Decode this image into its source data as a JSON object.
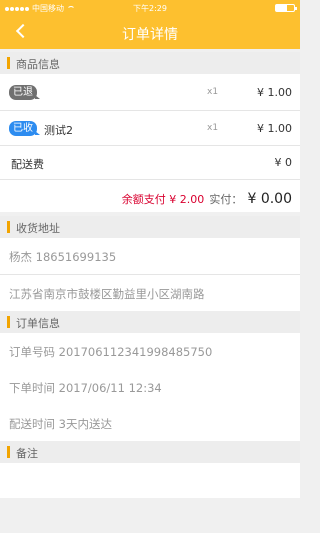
{
  "status_bar": {
    "carrier": "中国移动",
    "time": "下午2:29"
  },
  "nav": {
    "title": "订单详情"
  },
  "sections": {
    "goods": "商品信息",
    "address": "收货地址",
    "order": "订单信息",
    "remark": "备注"
  },
  "goods": [
    {
      "badge": "已退",
      "name": "",
      "qty": "x1",
      "price": "¥ 1.00"
    },
    {
      "badge": "已收",
      "name": "测试2",
      "qty": "x1",
      "price": "¥ 1.00"
    }
  ],
  "delivery_fee": {
    "label": "配送费",
    "value": "¥ 0"
  },
  "summary": {
    "balance": "余额支付 ¥ 2.00",
    "paid_label": "实付：",
    "paid_value": "¥ 0.00"
  },
  "address": {
    "name_phone": "杨杰  18651699135",
    "detail": "江苏省南京市鼓楼区勤益里小区湖南路"
  },
  "order": {
    "number": "订单号码  20170611234199848​5750",
    "created": "下单时间  2017/06/11 12:34",
    "delivery": "配送时间  3天内送达"
  },
  "colors": {
    "accent": "#fdc02f",
    "section_bar": "#f2a400",
    "balance": "#d9002f",
    "badge_returned": "#707070",
    "badge_received": "#2d8cf0"
  }
}
